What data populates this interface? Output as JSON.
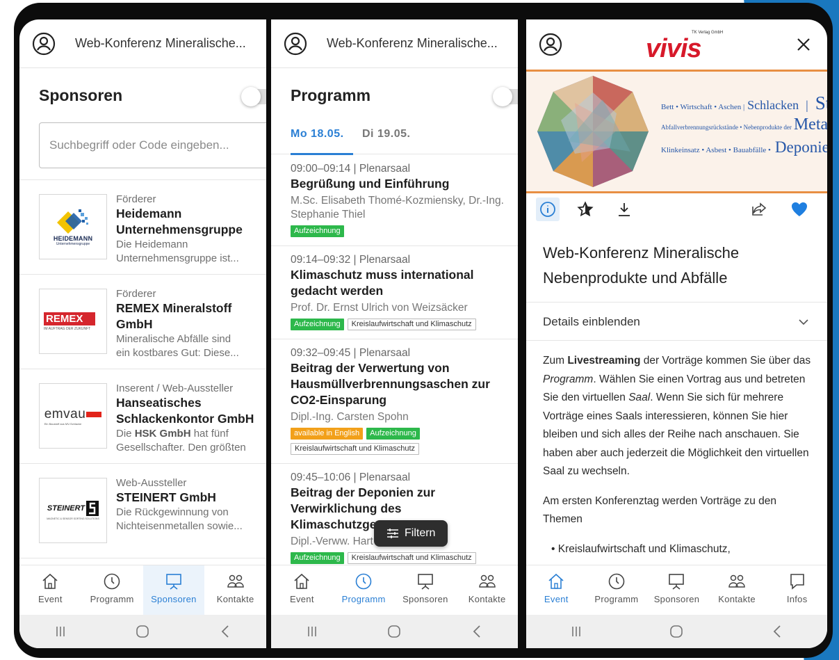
{
  "screen1": {
    "header_title": "Web-Konferenz Mineralische...",
    "section_title": "Sponsoren",
    "search_placeholder": "Suchbegriff oder Code eingeben...",
    "sponsors": [
      {
        "category": "Förderer",
        "name_lines": [
          "Heidemann",
          "Unternehmensgruppe"
        ],
        "desc_lines": [
          "Die Heidemann",
          "Unternehmensgruppe ist..."
        ],
        "logo_text": "HEIDEMANN",
        "logo_sub": "Unternehmensgruppe"
      },
      {
        "category": "Förderer",
        "name_lines": [
          "REMEX Mineralstoff",
          "GmbH"
        ],
        "desc_lines": [
          "Mineralische Abfälle sind",
          "ein kostbares Gut: Diese..."
        ],
        "logo_text": "REMEX",
        "logo_sub": "IM AUFTRAG DER ZUKUNFT"
      },
      {
        "category": "Inserent / Web-Aussteller",
        "name_lines": [
          "Hanseatisches",
          "Schlackenkontor GmbH"
        ],
        "desc_prefix": "Die ",
        "desc_bold": "HSK GmbH",
        "desc_suffix": " hat fünf",
        "desc_line2": "Gesellschafter. Den größten",
        "logo_text": "emvau",
        "logo_sub": "Ein Baustoff aus MV-Schlacke"
      },
      {
        "category": "Web-Aussteller",
        "name_lines": [
          "STEINERT GmbH"
        ],
        "desc_lines": [
          "Die Rückgewinnung von",
          "Nichteisenmetallen sowie..."
        ],
        "logo_text": "STEINERT",
        "logo_sub": "MAGNETIC & SENSOR SORTING SOLUTIONS"
      }
    ]
  },
  "screen2": {
    "header_title": "Web-Konferenz Mineralische...",
    "section_title": "Programm",
    "day_tabs": [
      "Mo 18.05.",
      "Di 19.05."
    ],
    "sessions": [
      {
        "time": "09:00–09:14 | Plenarsaal",
        "title_lines": [
          "Begrüßung und Einführung"
        ],
        "speaker_lines": [
          "M.Sc. Elisabeth Thomé-Kozmiensky, Dr.-Ing.",
          "Stephanie Thiel"
        ],
        "tags": [
          {
            "text": "Aufzeichnung",
            "style": "green"
          }
        ]
      },
      {
        "time": "09:14–09:32 | Plenarsaal",
        "title_lines": [
          "Klimaschutz muss international",
          "gedacht werden"
        ],
        "speaker_lines": [
          "Prof. Dr. Ernst Ulrich von Weizsäcker"
        ],
        "tags": [
          {
            "text": "Aufzeichnung",
            "style": "green"
          },
          {
            "text": "Kreislaufwirtschaft und Klimaschutz",
            "style": "outline"
          }
        ]
      },
      {
        "time": "09:32–09:45 | Plenarsaal",
        "title_lines": [
          "Beitrag der Verwertung von",
          "Hausmüllverbrennungsaschen zur",
          "CO2-Einsparung"
        ],
        "speaker_lines": [
          "Dipl.-Ing. Carsten Spohn"
        ],
        "tags": [
          {
            "text": "available in English",
            "style": "orange"
          },
          {
            "text": "Aufzeichnung",
            "style": "green"
          },
          {
            "text": "Kreislaufwirtschaft und Klimaschutz",
            "style": "outline"
          }
        ]
      },
      {
        "time": "09:45–10:06 | Plenarsaal",
        "title_lines": [
          "Beitrag der Deponien zur",
          "Verwirklichung des",
          "Klimaschutzge"
        ],
        "speaker_lines": [
          "Dipl.-Verww. Hart"
        ],
        "tags": [
          {
            "text": "Aufzeichnung",
            "style": "green"
          },
          {
            "text": "Kreislaufwirtschaft und Klimaschutz",
            "style": "outline"
          }
        ]
      }
    ],
    "filter_label": "Filtern"
  },
  "screen3": {
    "logo_text": "vivis",
    "logo_small": "TK Verlag GmbH",
    "banner": {
      "line1_small": "Bett • Wirtschaft • Aschen |",
      "line1_mid": "Schlacken",
      "line1_sep": "|",
      "line1_big": "Stäube",
      "line2_small": "Abfallverbrennungsrückstände • Nebenprodukte der",
      "line2_big": "Metallurgie",
      "line3_small": "Klinkeinsatz • Asbest • Bauabfälle •",
      "line3_big": "Deponiebedarf"
    },
    "event_title_lines": [
      "Web-Konferenz Mineralische",
      "Nebenprodukte und Abfälle"
    ],
    "details_label": "Details einblenden",
    "p1": {
      "a": "Zum ",
      "b": "Livestreaming",
      "c": " der Vorträge kommen Sie über das ",
      "d": "Programm",
      "e": ". Wählen Sie einen Vortrag aus und betreten Sie den virtuellen ",
      "f": "Saal",
      "g": ". Wenn Sie sich für mehrere Vorträge eines Saals interessieren, können Sie hier bleiben und sich alles der Reihe nach anschauen. Sie haben aber auch jederzeit die Möglichkeit den virtuellen Saal zu wechseln."
    },
    "p2": "Am ersten Konferenztag werden Vorträge zu den Themen",
    "bullets": [
      "Kreislaufwirtschaft und Klimaschutz,"
    ]
  },
  "nav": {
    "event": "Event",
    "programm": "Programm",
    "sponsoren": "Sponsoren",
    "kontakte": "Kontakte",
    "infos": "Infos"
  },
  "colors": {
    "accent": "#2a7fd4",
    "tag_green": "#2db84b",
    "tag_orange": "#f2a01a",
    "vivis_red": "#d7192a",
    "banner_border": "#e88f43",
    "heart": "#1f7fe0"
  },
  "icons": [
    "account-circle-icon",
    "close-icon",
    "info-icon",
    "star-icon",
    "download-icon",
    "share-icon",
    "heart-icon",
    "chevron-down-icon",
    "filter-icon",
    "home-icon",
    "clock-icon",
    "presentation-icon",
    "people-icon",
    "chat-icon"
  ]
}
